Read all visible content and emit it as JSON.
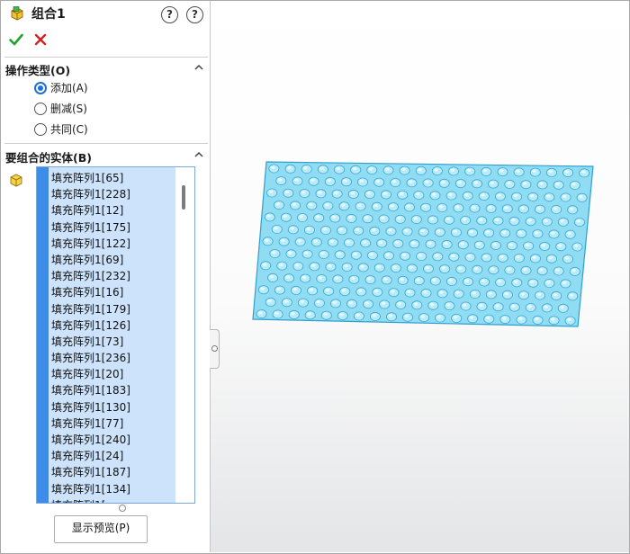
{
  "feature": {
    "title": "组合1",
    "ok_icon": "checkmark-icon",
    "cancel_icon": "x-icon",
    "help_icons": [
      "detailed-help-icon",
      "help-icon"
    ],
    "help_glyphs": [
      "?",
      "?"
    ]
  },
  "operation_type": {
    "title": "操作类型(O)",
    "options": [
      {
        "label": "添加(A)",
        "selected": true
      },
      {
        "label": "删减(S)",
        "selected": false
      },
      {
        "label": "共同(C)",
        "selected": false
      }
    ]
  },
  "bodies": {
    "title": "要组合的实体(B)",
    "items": [
      "填充阵列1[65]",
      "填充阵列1[228]",
      "填充阵列1[12]",
      "填充阵列1[175]",
      "填充阵列1[122]",
      "填充阵列1[69]",
      "填充阵列1[232]",
      "填充阵列1[16]",
      "填充阵列1[179]",
      "填充阵列1[126]",
      "填充阵列1[73]",
      "填充阵列1[236]",
      "填充阵列1[20]",
      "填充阵列1[183]",
      "填充阵列1[130]",
      "填充阵列1[77]",
      "填充阵列1[240]",
      "填充阵列1[24]",
      "填充阵列1[187]",
      "填充阵列1[134]",
      "填充阵列1[..."
    ]
  },
  "preview_button": "显示预览(P)",
  "colors": {
    "accent": "#1e6fd6",
    "selection": "#cce3fb",
    "selection_stripe": "#3b8de8",
    "plate_fill": "#8fdcf3",
    "ok_green": "#22a02c",
    "cancel_red": "#d42020"
  }
}
